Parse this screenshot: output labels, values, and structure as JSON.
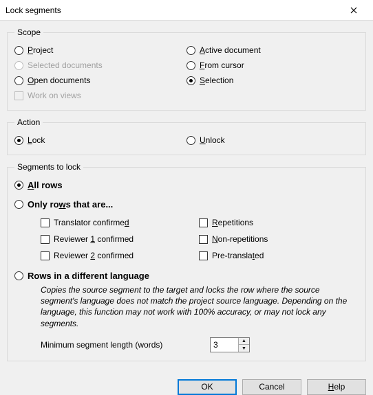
{
  "window": {
    "title": "Lock segments"
  },
  "scope": {
    "legend": "Scope",
    "left": [
      {
        "label": "Project",
        "ukey": "P",
        "rest": "roject",
        "sel": false,
        "disabled": false,
        "type": "radio"
      },
      {
        "label": "Selected documents",
        "ukey": "",
        "rest": "Selected documents",
        "sel": false,
        "disabled": true,
        "type": "radio"
      },
      {
        "label": "Open documents",
        "ukey": "O",
        "rest": "pen documents",
        "sel": false,
        "disabled": false,
        "type": "radio"
      },
      {
        "label": "Work on views",
        "ukey": "",
        "rest": "Work on views",
        "sel": false,
        "disabled": true,
        "type": "check"
      }
    ],
    "right": [
      {
        "label": "Active document",
        "ukey": "A",
        "rest": "ctive document",
        "sel": false,
        "disabled": false,
        "type": "radio"
      },
      {
        "label": "From cursor",
        "ukey": "F",
        "rest": "rom cursor",
        "sel": false,
        "disabled": false,
        "type": "radio"
      },
      {
        "label": "Selection",
        "ukey": "S",
        "rest": "election",
        "sel": true,
        "disabled": false,
        "type": "radio"
      }
    ]
  },
  "action": {
    "legend": "Action",
    "lock": {
      "ukey": "L",
      "rest": "ock",
      "sel": true
    },
    "unlock": {
      "ukey": "U",
      "rest": "nlock",
      "sel": false
    }
  },
  "segments": {
    "legend": "Segments to lock",
    "allrows": {
      "pre": "",
      "ukey": "A",
      "mid": "ll rows",
      "sel": true
    },
    "onlyrows": {
      "pre": "Only ro",
      "ukey": "w",
      "mid": "s that are...",
      "sel": false
    },
    "filters_left": [
      {
        "pre": "Translator confirme",
        "ukey": "d",
        "post": ""
      },
      {
        "pre": "Reviewer ",
        "ukey": "1",
        "post": " confirmed"
      },
      {
        "pre": "Reviewer ",
        "ukey": "2",
        "post": " confirmed"
      }
    ],
    "filters_right": [
      {
        "pre": "",
        "ukey": "R",
        "post": "epetitions"
      },
      {
        "pre": "",
        "ukey": "N",
        "post": "on-repetitions"
      },
      {
        "pre": "Pre-transla",
        "ukey": "t",
        "post": "ed"
      }
    ],
    "difflang": {
      "pre": "Rows in a different lan",
      "ukey": "g",
      "post": "uage",
      "sel": false
    },
    "description": "Copies the source segment to the target and locks the row where the source segment's language does not match the project source language. Depending on the language, this function may not work with 100% accuracy, or may not lock any segments.",
    "minlen_label": "Minimum segment length (words)",
    "minlen_value": "3"
  },
  "buttons": {
    "ok": "OK",
    "cancel": "Cancel",
    "help": {
      "ukey": "H",
      "rest": "elp"
    }
  }
}
